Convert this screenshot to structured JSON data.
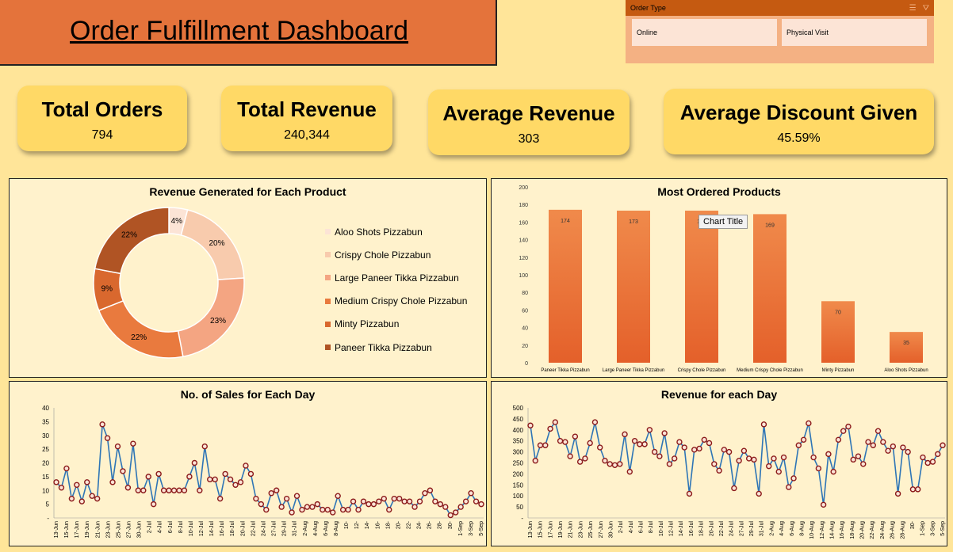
{
  "title": "Order Fulfillment Dashboard",
  "slicer": {
    "header": "Order Type",
    "items": [
      "Online",
      "Physical Visit"
    ],
    "icons": [
      "multi-select-icon",
      "clear-filter-icon"
    ]
  },
  "kpis": [
    {
      "label": "Total Orders",
      "value": "794"
    },
    {
      "label": "Total Revenue",
      "value": "240,344"
    },
    {
      "label": "Average Revenue",
      "value": "303"
    },
    {
      "label": "Average Discount Given",
      "value": "45.59%"
    }
  ],
  "donut": {
    "title": "Revenue Generated for Each Product",
    "chart_data": {
      "type": "pie",
      "categories": [
        "Aloo Shots Pizzabun",
        "Crispy Chole Pizzabun",
        "Large Paneer Tikka Pizzabun",
        "Medium Crispy Chole Pizzabun",
        "Minty Pizzabun",
        "Paneer Tikka Pizzabun"
      ],
      "values": [
        4,
        20,
        23,
        22,
        9,
        22
      ],
      "labels": [
        "4%",
        "20%",
        "23%",
        "22%",
        "9%",
        "22%"
      ],
      "colors": [
        "#fce4d6",
        "#f8cbad",
        "#f4a582",
        "#e97a3e",
        "#d9682e",
        "#b05424"
      ]
    }
  },
  "bar": {
    "title": "Most Ordered Products",
    "tooltip": "Chart Title",
    "chart_data": {
      "type": "bar",
      "categories": [
        "Paneer Tikka Pizzabun",
        "Large Paneer Tikka Pizzabun",
        "Crispy Chole Pizzabun",
        "Medium Crispy Chole Pizzabun",
        "Minty Pizzabun",
        "Aloo Shots Pizzabun"
      ],
      "values": [
        174,
        173,
        173,
        169,
        70,
        35
      ],
      "ylim": [
        0,
        200
      ],
      "yticks": [
        "0",
        "20",
        "40",
        "60",
        "80",
        "100",
        "120",
        "140",
        "160",
        "180",
        "200"
      ]
    }
  },
  "sales": {
    "title": "No. of Sales for Each Day",
    "chart_data": {
      "type": "line",
      "ylim": [
        0,
        40
      ],
      "yticks": [
        "-",
        "5",
        "10",
        "15",
        "20",
        "25",
        "30",
        "35",
        "40"
      ],
      "xticks": [
        "13-Jun",
        "15-Jun",
        "17-Jun",
        "19-Jun",
        "21-Jun",
        "23-Jun",
        "25-Jun",
        "27-Jun",
        "30-Jun",
        "2-Jul",
        "4-Jul",
        "6-Jul",
        "8-Jul",
        "10-Jul",
        "12-Jul",
        "14-Jul",
        "16-Jul",
        "18-Jul",
        "20-Jul",
        "22-Jul",
        "24-Jul",
        "27-Jul",
        "29-Jul",
        "31-Jul",
        "2-Aug",
        "4-Aug",
        "6-Aug",
        "8-Aug",
        "10-",
        "12-",
        "14-",
        "16-",
        "18-",
        "20-",
        "22-",
        "24-",
        "26-",
        "28-",
        "30-",
        "1-Sep",
        "3-Sep",
        "5-Sep"
      ],
      "values": [
        13,
        11,
        18,
        7,
        12,
        6,
        13,
        8,
        7,
        34,
        29,
        13,
        26,
        17,
        11,
        27,
        10,
        10,
        15,
        5,
        16,
        10,
        10,
        10,
        10,
        10,
        15,
        20,
        10,
        26,
        14,
        14,
        7,
        16,
        14,
        12,
        13,
        19,
        16,
        7,
        5,
        3,
        9,
        10,
        4,
        7,
        2,
        8,
        3,
        4,
        4,
        5,
        3,
        3,
        2,
        8,
        3,
        3,
        6,
        3,
        6,
        5,
        5,
        6,
        7,
        3,
        7,
        7,
        6,
        6,
        4,
        6,
        9,
        10,
        6,
        5,
        4,
        1,
        2,
        4,
        6,
        9,
        6,
        5
      ]
    }
  },
  "revenue": {
    "title": "Revenue  for each Day",
    "chart_data": {
      "type": "line",
      "ylim": [
        0,
        500
      ],
      "yticks": [
        "-",
        "50",
        "100",
        "150",
        "200",
        "250",
        "300",
        "350",
        "400",
        "450",
        "500"
      ],
      "xticks": [
        "13-Jun",
        "15-Jun",
        "17-Jun",
        "19-Jun",
        "21-Jun",
        "23-Jun",
        "25-Jun",
        "27-Jun",
        "30-Jun",
        "2-Jul",
        "4-Jul",
        "6-Jul",
        "8-Jul",
        "10-Jul",
        "12-Jul",
        "14-Jul",
        "16-Jul",
        "18-Jul",
        "20-Jul",
        "22-Jul",
        "24-Jul",
        "27-Jul",
        "29-Jul",
        "31-Jul",
        "2-Aug",
        "4-Aug",
        "6-Aug",
        "8-Aug",
        "10-Aug",
        "12-Aug",
        "14-Aug",
        "16-Aug",
        "18-Aug",
        "20-Aug",
        "22-Aug",
        "24-Aug",
        "26-Aug",
        "28-Aug",
        "30-",
        "1-Sep",
        "3-Sep",
        "5-Sep"
      ],
      "values": [
        420,
        260,
        330,
        330,
        405,
        435,
        350,
        345,
        280,
        370,
        255,
        270,
        340,
        435,
        320,
        260,
        245,
        240,
        245,
        380,
        210,
        350,
        335,
        335,
        400,
        300,
        280,
        385,
        245,
        270,
        345,
        320,
        110,
        310,
        315,
        355,
        340,
        245,
        215,
        310,
        300,
        135,
        260,
        305,
        270,
        265,
        110,
        425,
        235,
        270,
        210,
        275,
        140,
        180,
        330,
        355,
        430,
        275,
        225,
        60,
        290,
        210,
        355,
        395,
        415,
        265,
        280,
        245,
        345,
        330,
        395,
        345,
        305,
        325,
        110,
        320,
        300,
        130,
        130,
        275,
        250,
        255,
        290,
        330
      ]
    }
  }
}
